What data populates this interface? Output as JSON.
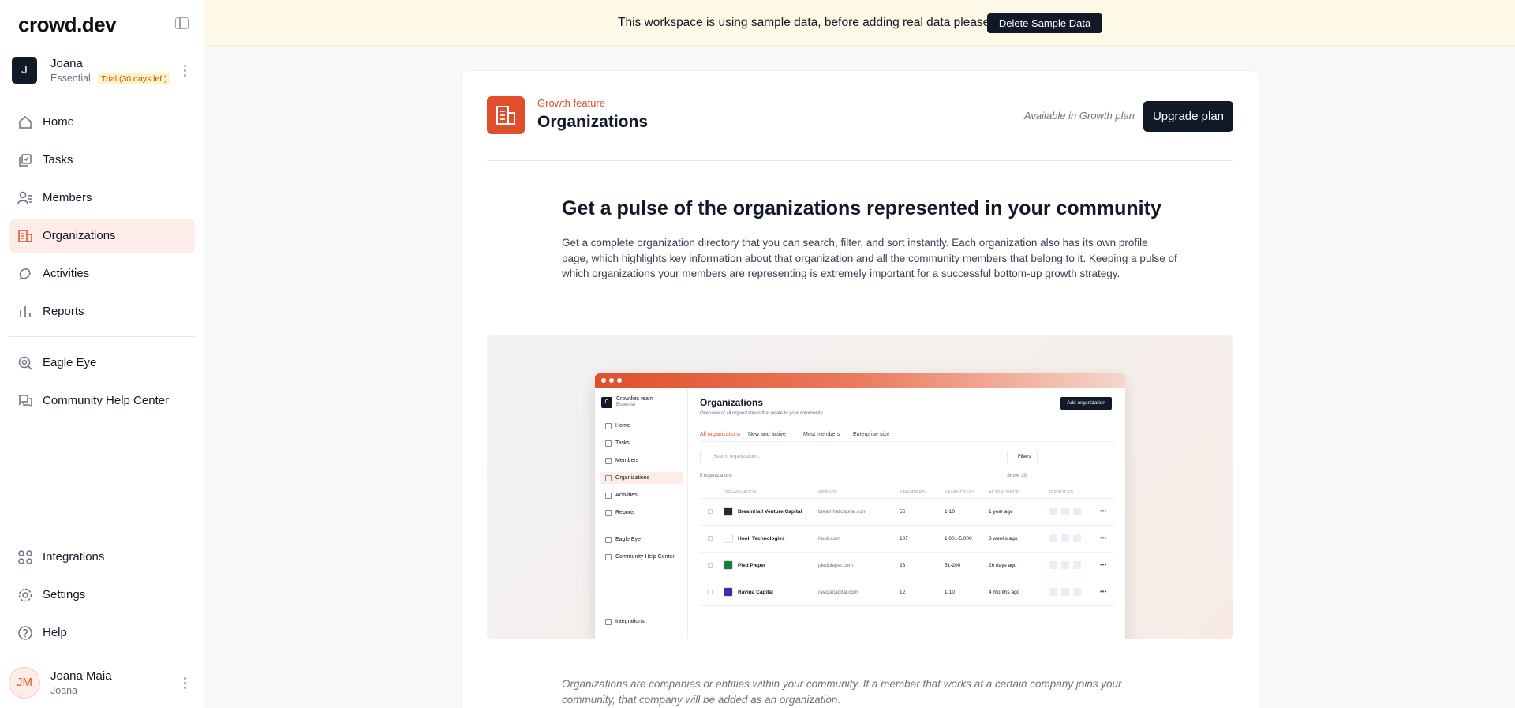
{
  "sidebar": {
    "logo": "crowd.dev",
    "workspace": {
      "initial": "J",
      "name": "Joana",
      "plan": "Essential",
      "trial": "Trial (30 days left)"
    },
    "nav": [
      {
        "label": "Home",
        "icon": "home-icon"
      },
      {
        "label": "Tasks",
        "icon": "tasks-icon"
      },
      {
        "label": "Members",
        "icon": "members-icon"
      },
      {
        "label": "Organizations",
        "icon": "organizations-icon",
        "active": true
      },
      {
        "label": "Activities",
        "icon": "activities-icon"
      },
      {
        "label": "Reports",
        "icon": "reports-icon"
      }
    ],
    "nav2": [
      {
        "label": "Eagle Eye",
        "icon": "eagle-eye-icon"
      },
      {
        "label": "Community Help Center",
        "icon": "help-center-icon"
      }
    ],
    "bottom": [
      {
        "label": "Integrations",
        "icon": "integrations-icon"
      },
      {
        "label": "Settings",
        "icon": "gear-icon"
      },
      {
        "label": "Help",
        "icon": "help-icon"
      }
    ],
    "user": {
      "initials": "JM",
      "name": "Joana Maia",
      "sub": "Joana"
    }
  },
  "banner": {
    "text": "This workspace is using sample data, before adding real data please",
    "button": "Delete Sample Data"
  },
  "card": {
    "kicker": "Growth feature",
    "title": "Organizations",
    "available": "Available in Growth plan",
    "upgrade": "Upgrade plan",
    "headline": "Get a pulse of the organizations represented in your community",
    "paragraph": "Get a complete organization directory that you can search, filter, and sort instantly. Each organization also has its own profile page, which highlights key information about that organization and all the community members that belong to it. Keeping a pulse of which organizations your members are representing is extremely important for a successful bottom-up growth strategy.",
    "footnote": "Organizations are companies or entities within your community. If a member that works at a certain company joins your community, that company will be added as an organization."
  },
  "preview": {
    "workspace": {
      "initial": "C",
      "name": "Crowdies team",
      "plan": "Essential"
    },
    "nav": [
      "Home",
      "Tasks",
      "Members",
      "Organizations",
      "Activities",
      "Reports",
      "Eagle Eye",
      "Community Help Center",
      "Integrations"
    ],
    "title": "Organizations",
    "subtitle": "Overview of all organizations that relate to your community",
    "add_button": "Add organization",
    "tabs": [
      "All organizations",
      "New and active",
      "Most members",
      "Enterprise size"
    ],
    "search_placeholder": "Search organizations...",
    "filters": "Filters",
    "count": "5 organizations",
    "show": "Show: 20",
    "columns": [
      "ORGANIZATION",
      "WEBSITE",
      "# MEMBERS",
      "# EMPLOYEES",
      "ACTIVE SINCE",
      "IDENTITIES"
    ],
    "rows": [
      {
        "name": "BreamHall Venture Capital",
        "website": "breamhallcapital.com",
        "members": "55",
        "employees": "1-10",
        "since": "1 year ago",
        "logo_color": "#1f2937"
      },
      {
        "name": "Hooli Technologies",
        "website": "hooli.com",
        "members": "107",
        "employees": "1,001-5,000",
        "since": "3 weeks ago",
        "logo_color": "#ffffff"
      },
      {
        "name": "Pied Pieper",
        "website": "piedpieper.com",
        "members": "28",
        "employees": "51-200",
        "since": "26 days ago",
        "logo_color": "#15803d"
      },
      {
        "name": "Raviga Capital",
        "website": "ravigacapital.com",
        "members": "12",
        "employees": "1-10",
        "since": "4 months ago",
        "logo_color": "#3730a3"
      }
    ]
  }
}
